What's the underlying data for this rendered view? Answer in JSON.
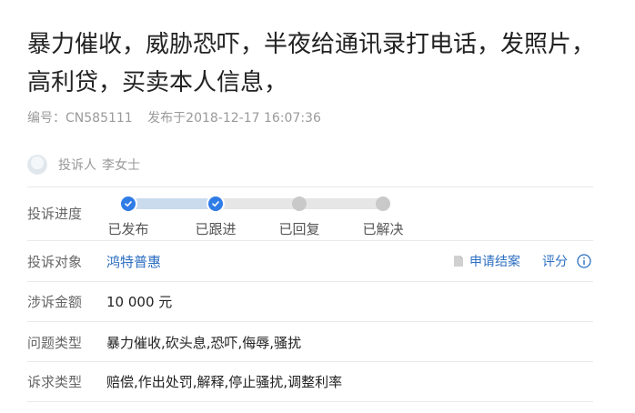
{
  "title": "暴力催收，威胁恐吓，半夜给通讯录打电话，发照片，高利贷，买卖本人信息，",
  "meta": {
    "id_label": "编号：",
    "id_value": "CN585111",
    "publish_label": "发布于",
    "publish_time": "2018-12-17 16:07:36"
  },
  "complainant": {
    "label": "投诉人",
    "name": "李女士"
  },
  "progress": {
    "label": "投诉进度",
    "steps": [
      {
        "label": "已发布",
        "done": true
      },
      {
        "label": "已跟进",
        "done": true
      },
      {
        "label": "已回复",
        "done": false
      },
      {
        "label": "已解决",
        "done": false
      }
    ]
  },
  "target": {
    "label": "投诉对象",
    "value": "鸿特普惠",
    "apply_close": "申请结案",
    "rate": "评分"
  },
  "amount": {
    "label": "涉诉金额",
    "value": "10 000 元"
  },
  "problem_type": {
    "label": "问题类型",
    "value": "暴力催收,砍头息,恐吓,侮辱,骚扰"
  },
  "demand_type": {
    "label": "诉求类型",
    "value": "赔偿,作出处罚,解释,停止骚扰,调整利率"
  }
}
